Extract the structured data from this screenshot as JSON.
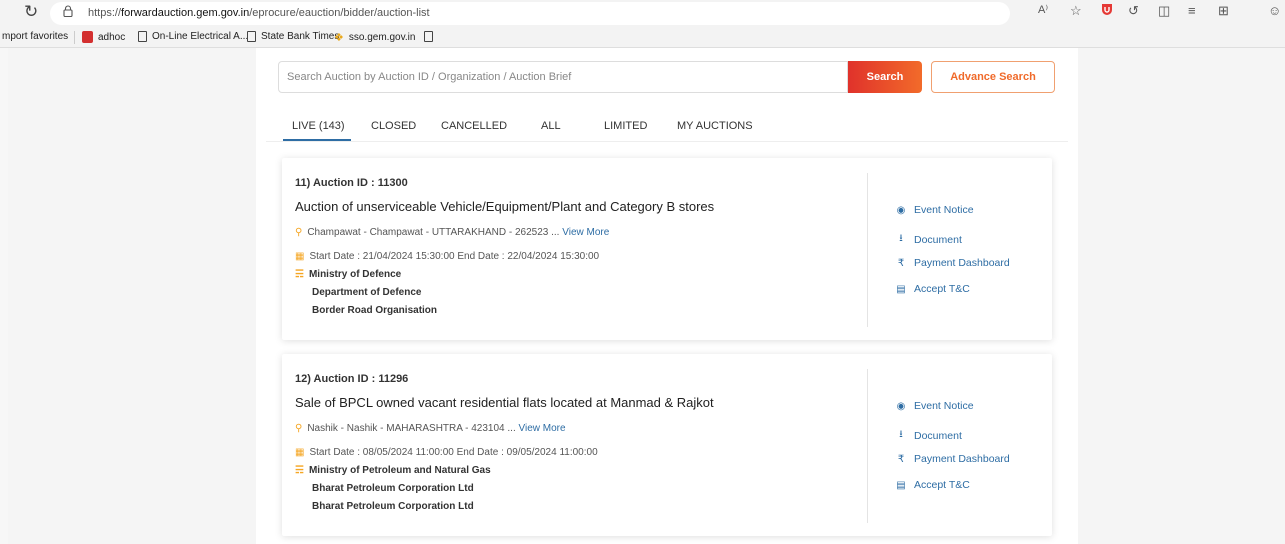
{
  "browser": {
    "url_prefix": "https://",
    "url_host": "forwardauction.gem.gov.in",
    "url_path": "/eprocure/eauction/bidder/auction-list",
    "reader_label": "A⁾"
  },
  "favorites_bar": {
    "items": [
      "mport favorites",
      "adhoc",
      "On-Line Electrical A...",
      "State Bank Times",
      "sso.gem.gov.in"
    ]
  },
  "search": {
    "placeholder": "Search Auction by Auction ID / Organization / Auction Brief",
    "value": "",
    "button_label": "Search",
    "advance_label": "Advance Search"
  },
  "tabs": [
    "LIVE (143)",
    "CLOSED",
    "CANCELLED",
    "ALL",
    "LIMITED",
    "MY AUCTIONS"
  ],
  "active_tab": "LIVE (143)",
  "auctions": [
    {
      "id_line": "11) Auction ID : 11300",
      "title": "Auction of unserviceable Vehicle/Equipment/Plant and Category B stores",
      "location": "Champawat  - Champawat - UTTARAKHAND - 262523 ...",
      "view_more": "View More",
      "dates": "Start Date : 21/04/2024 15:30:00   End Date : 22/04/2024 15:30:00",
      "ministry": "Ministry of Defence",
      "department": "Department of Defence",
      "organisation": "Border Road Organisation"
    },
    {
      "id_line": "12) Auction ID : 11296",
      "title": "Sale of BPCL owned vacant residential flats located at Manmad & Rajkot",
      "location": "Nashik  - Nashik - MAHARASHTRA - 423104 ...",
      "view_more": "View More",
      "dates": "Start Date : 08/05/2024 11:00:00   End Date : 09/05/2024 11:00:00",
      "ministry": "Ministry of Petroleum and Natural Gas",
      "department": "Bharat Petroleum Corporation Ltd",
      "organisation": "Bharat Petroleum Corporation Ltd"
    }
  ],
  "actions": [
    "Event Notice",
    "Document",
    "Payment Dashboard",
    "Accept T&C"
  ],
  "colors": {
    "accent_blue": "#2e6da4",
    "search_red": "#e0322b",
    "search_orange": "#f26b2a",
    "icon_orange": "#f5a623"
  }
}
